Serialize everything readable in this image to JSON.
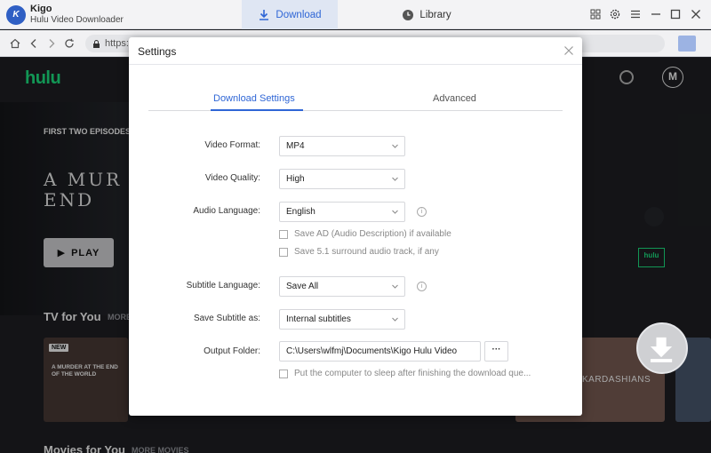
{
  "app": {
    "name": "Kigo",
    "subtitle": "Hulu Video Downloader",
    "logo_text": "K"
  },
  "tabs": {
    "download": "Download",
    "library": "Library"
  },
  "address": {
    "url": "https:"
  },
  "hulu": {
    "logo": "hulu",
    "avatar": "M",
    "hero_eyebrow": "FIRST TWO EPISODES",
    "hero_title_1": "A MUR",
    "hero_title_2": "END",
    "play_label": "PLAY",
    "section_tv": "TV for You",
    "section_tv_more": "MORE",
    "new_badge": "NEW",
    "card_1_title": "A MURDER AT THE END OF THE WORLD",
    "card_r1_title": "KARDASHIANS",
    "originals_badge": "hulu",
    "section_movies": "Movies for You",
    "section_movies_more": "MORE MOVIES"
  },
  "settings": {
    "title": "Settings",
    "tab_download": "Download Settings",
    "tab_advanced": "Advanced",
    "video_format": {
      "label": "Video Format:",
      "value": "MP4"
    },
    "video_quality": {
      "label": "Video Quality:",
      "value": "High"
    },
    "audio_language": {
      "label": "Audio Language:",
      "value": "English"
    },
    "save_ad": "Save AD (Audio Description) if available",
    "save_51": "Save 5.1 surround audio track, if any",
    "subtitle_language": {
      "label": "Subtitle Language:",
      "value": "Save All"
    },
    "save_subtitle_as": {
      "label": "Save Subtitle as:",
      "value": "Internal subtitles"
    },
    "output_folder": {
      "label": "Output Folder:",
      "value": "C:\\Users\\wlfmj\\Documents\\Kigo Hulu Video",
      "browse": "···"
    },
    "sleep_label": "Put the computer to sleep after finishing the download que..."
  },
  "colors": {
    "accent": "#2f66d6",
    "hulu_green": "#1ce783"
  }
}
